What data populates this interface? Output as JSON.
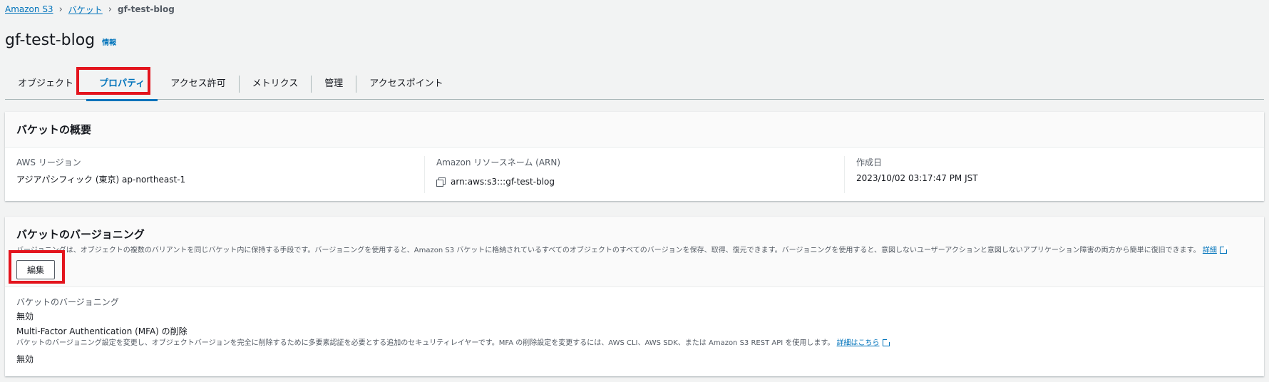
{
  "breadcrumb": {
    "items": [
      "Amazon S3",
      "バケット"
    ],
    "current": "gf-test-blog"
  },
  "page": {
    "title": "gf-test-blog",
    "info_label": "情報"
  },
  "tabs": [
    {
      "label": "オブジェクト"
    },
    {
      "label": "プロパティ"
    },
    {
      "label": "アクセス許可"
    },
    {
      "label": "メトリクス"
    },
    {
      "label": "管理"
    },
    {
      "label": "アクセスポイント"
    }
  ],
  "overview": {
    "title": "バケットの概要",
    "region_label": "AWS リージョン",
    "region_value": "アジアパシフィック (東京) ap-northeast-1",
    "arn_label": "Amazon リソースネーム (ARN)",
    "arn_value": "arn:aws:s3:::gf-test-blog",
    "created_label": "作成日",
    "created_value": "2023/10/02 03:17:47 PM JST"
  },
  "versioning": {
    "title": "バケットのバージョニング",
    "description": "バージョニングは、オブジェクトの複数のバリアントを同じバケット内に保持する手段です。バージョニングを使用すると、Amazon S3 バケットに格納されているすべてのオブジェクトのすべてのバージョンを保存、取得、復元できます。バージョニングを使用すると、意図しないユーザーアクションと意図しないアプリケーション障害の両方から簡単に復旧できます。",
    "details_link": "詳細",
    "edit_label": "編集",
    "status_label": "バケットのバージョニング",
    "status_value": "無効",
    "mfa_label": "Multi-Factor Authentication (MFA) の削除",
    "mfa_description": "バケットのバージョニング設定を変更し、オブジェクトバージョンを完全に削除するために多要素認証を必要とする追加のセキュリティレイヤーです。MFA の削除設定を変更するには、AWS CLI、AWS SDK、または Amazon S3 REST API を使用します。",
    "mfa_link": "詳細はこちら",
    "mfa_value": "無効"
  },
  "colors": {
    "link": "#0073bb",
    "highlight": "#e3141d",
    "background": "#f2f3f3"
  }
}
